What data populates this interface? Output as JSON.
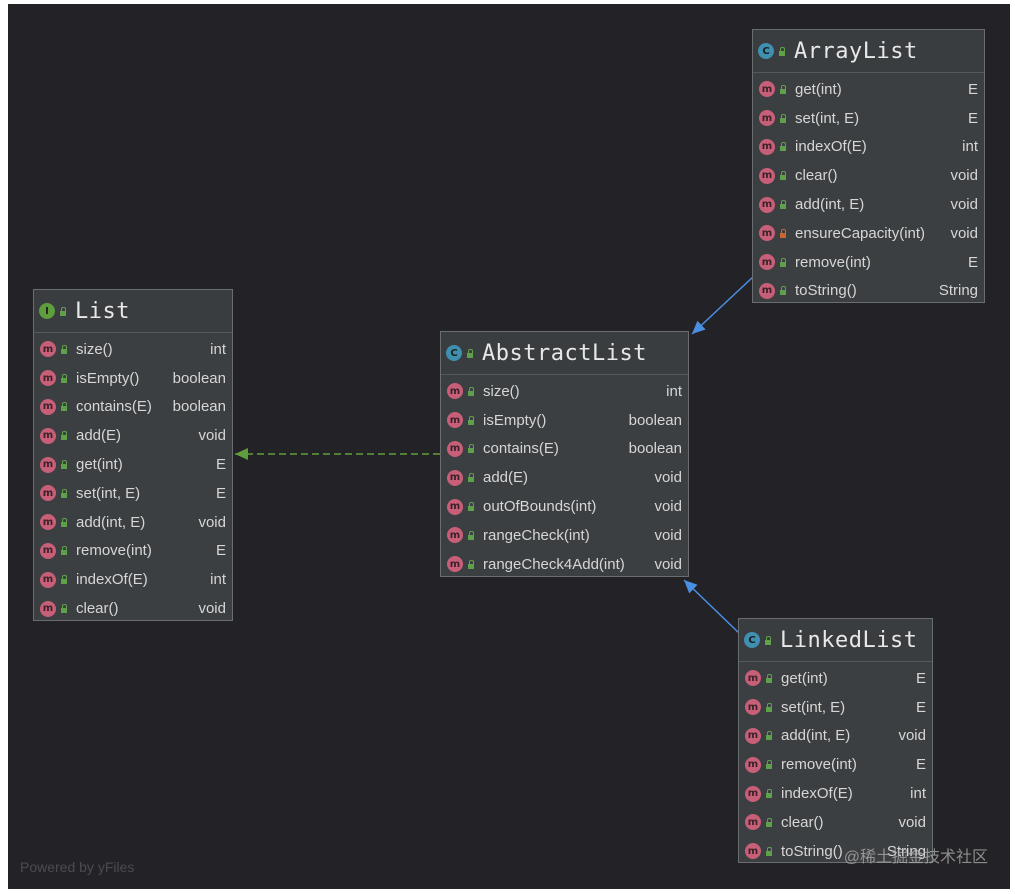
{
  "footer": "Powered by yFiles",
  "watermark": "@稀土掘金技术社区",
  "classes": {
    "list": {
      "name": "List",
      "kind": "I",
      "members": [
        {
          "sig": "size()",
          "ret": "int"
        },
        {
          "sig": "isEmpty()",
          "ret": "boolean"
        },
        {
          "sig": "contains(E)",
          "ret": "boolean"
        },
        {
          "sig": "add(E)",
          "ret": "void"
        },
        {
          "sig": "get(int)",
          "ret": "E"
        },
        {
          "sig": "set(int, E)",
          "ret": "E"
        },
        {
          "sig": "add(int, E)",
          "ret": "void"
        },
        {
          "sig": "remove(int)",
          "ret": "E"
        },
        {
          "sig": "indexOf(E)",
          "ret": "int"
        },
        {
          "sig": "clear()",
          "ret": "void"
        }
      ]
    },
    "abstract_list": {
      "name": "AbstractList",
      "kind": "C",
      "members": [
        {
          "sig": "size()",
          "ret": "int"
        },
        {
          "sig": "isEmpty()",
          "ret": "boolean"
        },
        {
          "sig": "contains(E)",
          "ret": "boolean"
        },
        {
          "sig": "add(E)",
          "ret": "void"
        },
        {
          "sig": "outOfBounds(int)",
          "ret": "void"
        },
        {
          "sig": "rangeCheck(int)",
          "ret": "void"
        },
        {
          "sig": "rangeCheck4Add(int)",
          "ret": "void"
        }
      ]
    },
    "array_list": {
      "name": "ArrayList",
      "kind": "C",
      "members": [
        {
          "sig": "get(int)",
          "ret": "E"
        },
        {
          "sig": "set(int, E)",
          "ret": "E"
        },
        {
          "sig": "indexOf(E)",
          "ret": "int"
        },
        {
          "sig": "clear()",
          "ret": "void"
        },
        {
          "sig": "add(int, E)",
          "ret": "void"
        },
        {
          "sig": "ensureCapacity(int)",
          "ret": "void",
          "private": true
        },
        {
          "sig": "remove(int)",
          "ret": "E"
        },
        {
          "sig": "toString()",
          "ret": "String"
        }
      ]
    },
    "linked_list": {
      "name": "LinkedList",
      "kind": "C",
      "members": [
        {
          "sig": "get(int)",
          "ret": "E"
        },
        {
          "sig": "set(int, E)",
          "ret": "E"
        },
        {
          "sig": "add(int, E)",
          "ret": "void"
        },
        {
          "sig": "remove(int)",
          "ret": "E"
        },
        {
          "sig": "indexOf(E)",
          "ret": "int"
        },
        {
          "sig": "clear()",
          "ret": "void"
        },
        {
          "sig": "toString()",
          "ret": "String"
        }
      ]
    }
  },
  "relations": [
    {
      "from": "abstract_list",
      "to": "list",
      "type": "implements"
    },
    {
      "from": "array_list",
      "to": "abstract_list",
      "type": "extends"
    },
    {
      "from": "linked_list",
      "to": "abstract_list",
      "type": "extends"
    }
  ],
  "colors": {
    "background": "#232327",
    "box": "#3c3f41",
    "implements_edge": "#5f9e3c",
    "extends_edge": "#4a90e2",
    "method_badge": "#c85f78"
  }
}
